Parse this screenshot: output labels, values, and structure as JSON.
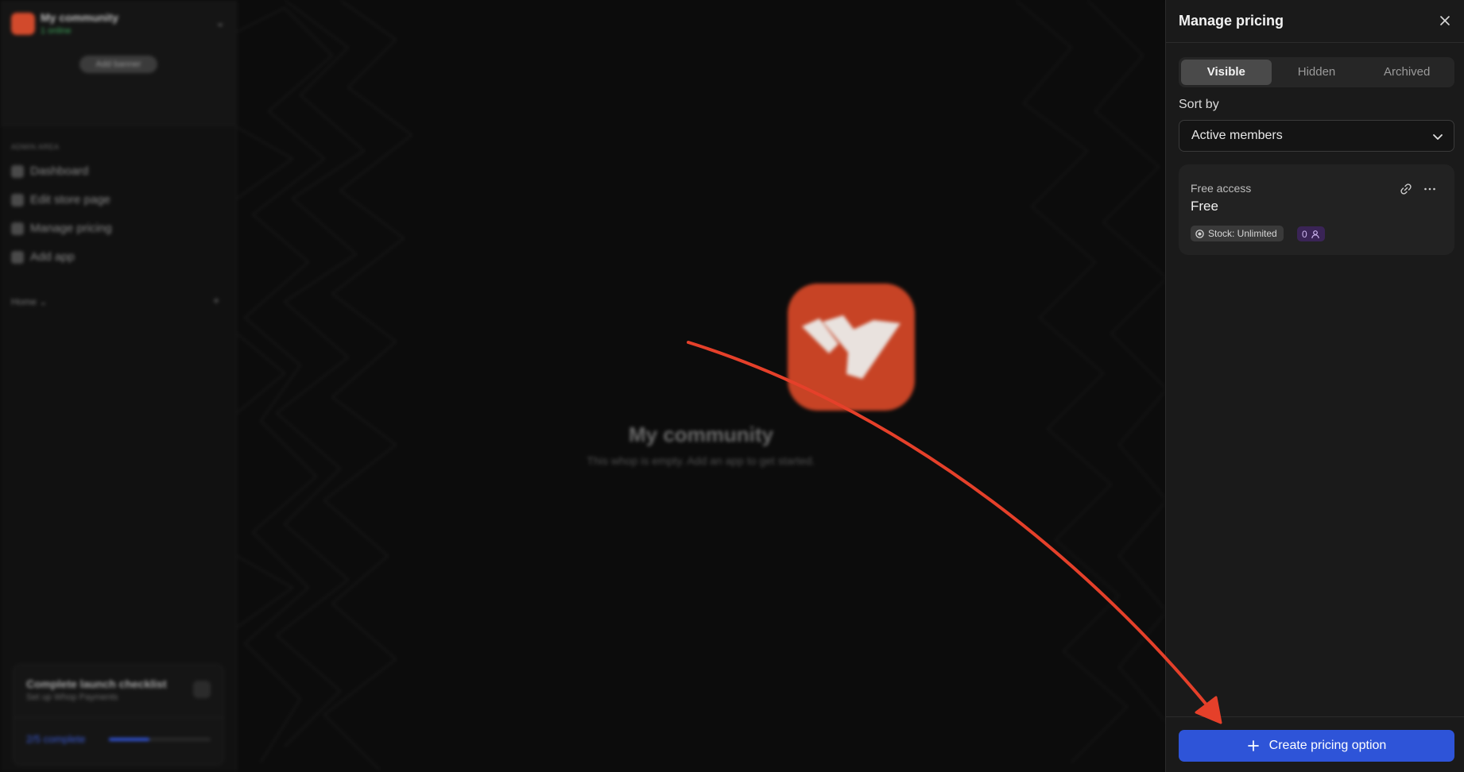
{
  "background": {
    "community_name": "My community",
    "online_status": "1 online",
    "banner_button": "Add banner",
    "section_label": "ADMIN AREA",
    "nav": [
      "Dashboard",
      "Edit store page",
      "Manage pricing",
      "Add app"
    ],
    "home_label": "Home",
    "checklist": {
      "title": "Complete launch checklist",
      "subtitle": "Set up Whop Payments",
      "progress_text": "2/5 complete",
      "progress_fraction": 0.4
    },
    "center_title": "My community",
    "center_subtitle": "This whop is empty. Add an app to get started."
  },
  "drawer": {
    "title": "Manage pricing",
    "tabs": [
      "Visible",
      "Hidden",
      "Archived"
    ],
    "active_tab": "Visible",
    "sort_label": "Sort by",
    "sort_value": "Active members",
    "plan": {
      "type": "Free access",
      "price": "Free",
      "stock": "Stock: Unlimited",
      "members": "0"
    },
    "create_button": "Create pricing option"
  },
  "colors": {
    "accent": "#2e54d8",
    "brand": "#c74325",
    "annotation_arrow": "#e5402a"
  }
}
